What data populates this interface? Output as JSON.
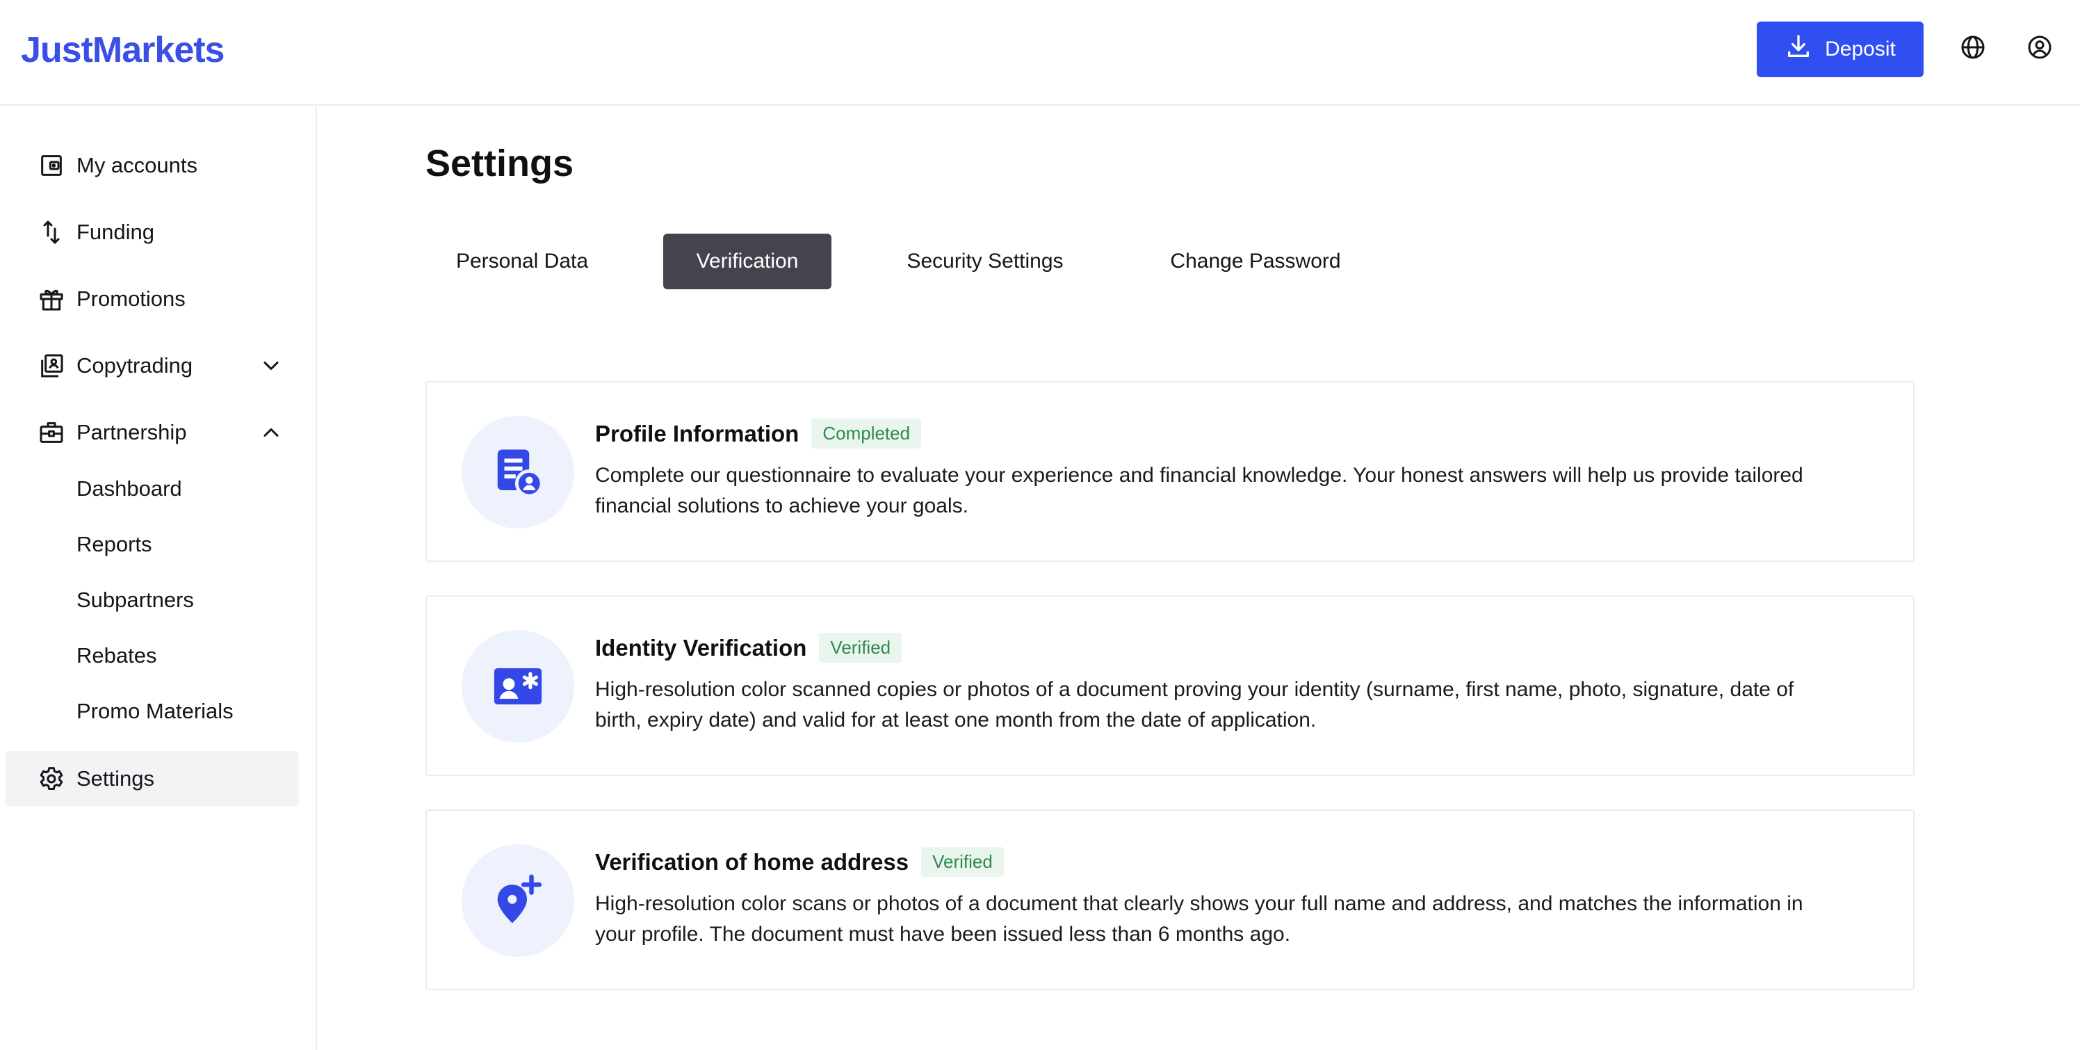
{
  "header": {
    "logo": "JustMarkets",
    "deposit_label": "Deposit",
    "icons": {
      "deposit": "download-icon",
      "language": "globe-icon",
      "profile": "user-circle-icon"
    },
    "accent_color": "#2f4ff0"
  },
  "sidebar": {
    "items": [
      {
        "label": "My accounts",
        "icon": "wallet-icon"
      },
      {
        "label": "Funding",
        "icon": "arrows-updown-icon"
      },
      {
        "label": "Promotions",
        "icon": "gift-icon"
      },
      {
        "label": "Copytrading",
        "icon": "copytrading-icon",
        "expanded": false
      },
      {
        "label": "Partnership",
        "icon": "briefcase-icon",
        "expanded": true
      },
      {
        "label": "Settings",
        "icon": "gear-icon",
        "active": true
      }
    ],
    "partnership_sub": [
      "Dashboard",
      "Reports",
      "Subpartners",
      "Rebates",
      "Promo Materials"
    ]
  },
  "main": {
    "title": "Settings",
    "tabs": [
      {
        "label": "Personal Data"
      },
      {
        "label": "Verification",
        "active": true
      },
      {
        "label": "Security Settings"
      },
      {
        "label": "Change Password"
      }
    ],
    "cards": [
      {
        "title": "Profile Information",
        "status": "Completed",
        "icon": "profile-document-icon",
        "description": "Complete our questionnaire to evaluate your experience and financial knowledge. Your honest answers will help us provide tailored financial solutions to achieve your goals."
      },
      {
        "title": "Identity Verification",
        "status": "Verified",
        "icon": "id-card-icon",
        "description": "High-resolution color scanned copies or photos of a document proving your identity (surname, first name, photo, signature, date of birth, expiry date) and valid for at least one month from the date of application."
      },
      {
        "title": "Verification of home address",
        "status": "Verified",
        "icon": "location-pin-plus-icon",
        "description": "High-resolution color scans or photos of a document that clearly shows your full name and address, and matches the information in your profile. The document must have been issued less than 6 months ago."
      }
    ]
  }
}
